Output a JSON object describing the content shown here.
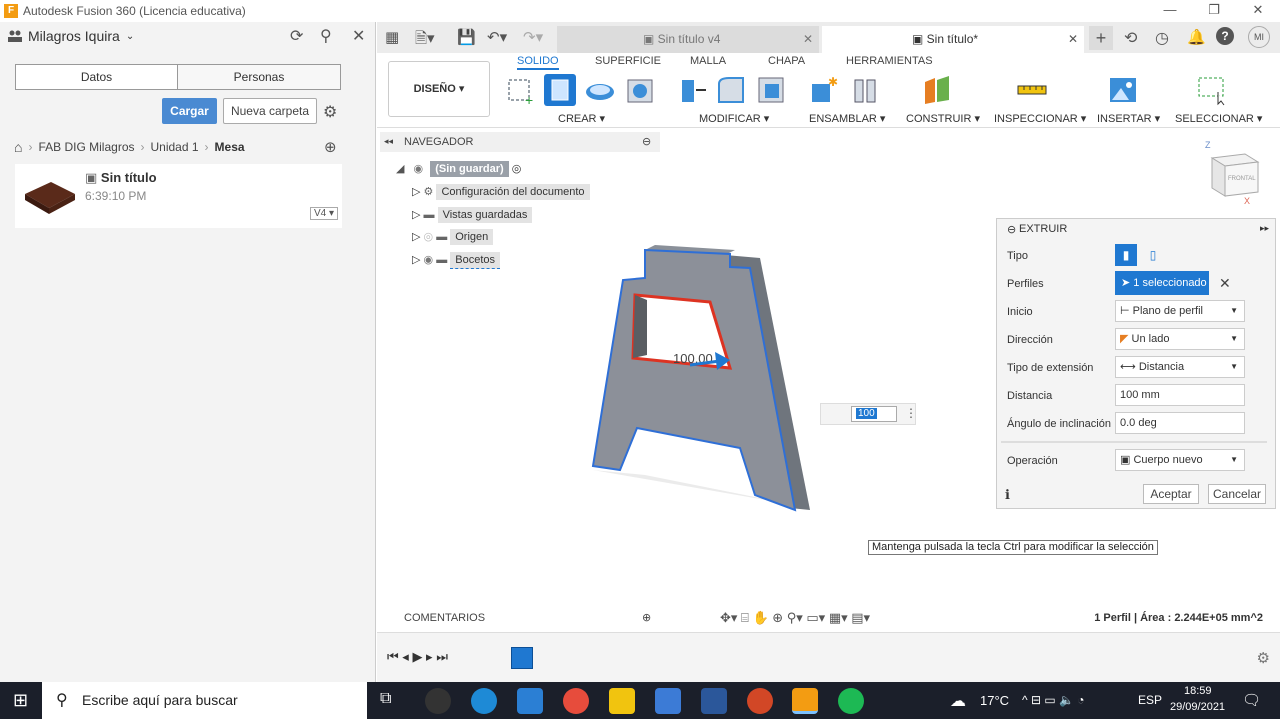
{
  "window": {
    "title": "Autodesk Fusion 360 (Licencia educativa)",
    "minimize": "—",
    "maximize": "❐",
    "close": "✕"
  },
  "left_panel": {
    "user": "Milagros Iquira",
    "tabs": [
      "Datos",
      "Personas"
    ],
    "upload_label": "Cargar",
    "new_folder_label": "Nueva carpeta",
    "breadcrumb": [
      "FAB DIG Milagros",
      "Unidad 1",
      "Mesa"
    ],
    "file": {
      "name": "Sin título",
      "time": "6:39:10 PM",
      "version": "V4 ▾"
    }
  },
  "tabs": [
    {
      "label": "Sin título v4"
    },
    {
      "label": "Sin título*"
    }
  ],
  "user_initials": "MI",
  "toolbar": {
    "design": "DISEÑO ▾",
    "subtabs": [
      "SOLIDO",
      "SUPERFICIE",
      "MALLA",
      "CHAPA",
      "HERRAMIENTAS"
    ],
    "groups": [
      "CREAR ▾",
      "MODIFICAR ▾",
      "ENSAMBLAR ▾",
      "CONSTRUIR ▾",
      "INSPECCIONAR ▾",
      "INSERTAR ▾",
      "SELECCIONAR ▾"
    ]
  },
  "navigator": {
    "title": "NAVEGADOR",
    "root": "(Sin guardar)",
    "items": [
      "Configuración del documento",
      "Vistas guardadas",
      "Origen",
      "Bocetos"
    ]
  },
  "viewcube": {
    "face": "FRONTAL",
    "z": "Z",
    "x": "X"
  },
  "extrude": {
    "title": "EXTRUIR",
    "rows": [
      {
        "label": "Tipo",
        "value": ""
      },
      {
        "label": "Perfiles",
        "value": "1 seleccionado"
      },
      {
        "label": "Inicio",
        "value": "Plano de perfil"
      },
      {
        "label": "Dirección",
        "value": "Un lado"
      },
      {
        "label": "Tipo de extensión",
        "value": "Distancia"
      },
      {
        "label": "Distancia",
        "value": "100 mm"
      },
      {
        "label": "Ángulo de inclinación",
        "value": "0.0 deg"
      },
      {
        "label": "Operación",
        "value": "Cuerpo nuevo"
      }
    ],
    "ok": "Aceptar",
    "cancel": "Cancelar"
  },
  "dimension_input": "100",
  "dimension_label": "100.00",
  "tooltip": "Mantenga pulsada la tecla Ctrl para modificar la selección",
  "comments_label": "COMENTARIOS",
  "status": "1 Perfil | Área : 2.244E+05 mm^2",
  "taskbar": {
    "search_placeholder": "Escribe aquí para buscar",
    "temperature": "17°C",
    "language": "ESP",
    "time": "18:59",
    "date": "29/09/2021"
  }
}
